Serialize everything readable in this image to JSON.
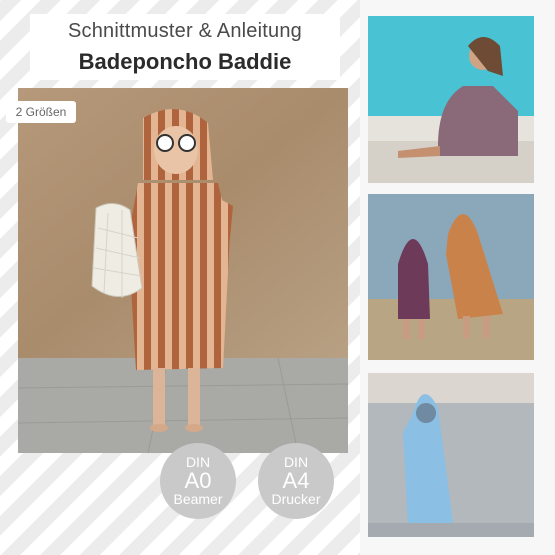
{
  "header": {
    "title": "Schnittmuster & Anleitung",
    "subtitle": "Badeponcho Baddie"
  },
  "badge": {
    "sizes": "2 Größen"
  },
  "formats": [
    {
      "top": "DIN",
      "size": "A0",
      "bottom": "Beamer"
    },
    {
      "top": "DIN",
      "size": "A4",
      "bottom": "Drucker"
    }
  ],
  "photos": {
    "main": "photo-child-striped-poncho",
    "side": [
      "photo-woman-pool",
      "photo-two-kids-beach",
      "photo-child-sea-poncho"
    ]
  },
  "colors": {
    "wall": "#b79a78",
    "poncho_stripe_dark": "#b2663f",
    "poncho_stripe_light": "#e4b896",
    "pool": "#45c6d6",
    "circle": "#c9c9c9"
  }
}
